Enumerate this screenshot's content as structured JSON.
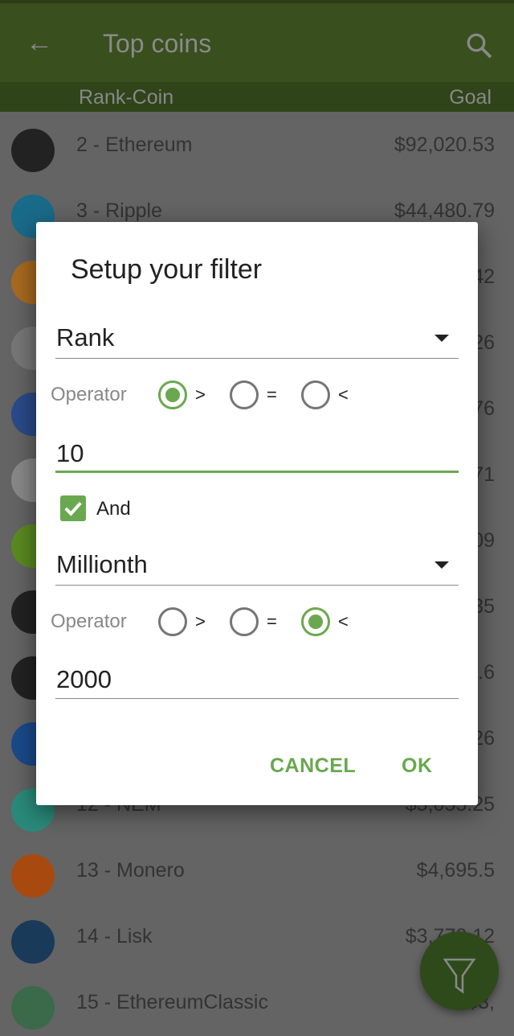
{
  "toolbar": {
    "title": "Top coins",
    "back_icon": "arrow-left-icon",
    "search_icon": "search-icon"
  },
  "header": {
    "rank_coin": "Rank-Coin",
    "goal": "Goal"
  },
  "coins": [
    {
      "name": "2 - Ethereum",
      "value": "$92,020.53",
      "color": "#222222"
    },
    {
      "name": "3 - Ripple",
      "value": "$44,480.79",
      "color": "#1a6a8a"
    },
    {
      "name": "",
      "value": "42",
      "color": "#a86a20"
    },
    {
      "name": "",
      "value": "26",
      "color": "#777777"
    },
    {
      "name": "",
      "value": "76",
      "color": "#2a4a8a"
    },
    {
      "name": "",
      "value": "71",
      "color": "#888888"
    },
    {
      "name": "",
      "value": "09",
      "color": "#5a8a20"
    },
    {
      "name": "",
      "value": "35",
      "color": "#222222"
    },
    {
      "name": "",
      "value": ".6",
      "color": "#222222"
    },
    {
      "name": "",
      "value": "26",
      "color": "#1a4a8a"
    },
    {
      "name": "12 - NEM",
      "value": "$5,055.25",
      "color": "#2a8a7a"
    },
    {
      "name": "13 - Monero",
      "value": "$4,695.5",
      "color": "#a84a10"
    },
    {
      "name": "14 - Lisk",
      "value": "$3,770.12",
      "color": "#1a3a5a"
    },
    {
      "name": "15 - EthereumClassic",
      "value": "$3,",
      "color": "#3a6a4a"
    }
  ],
  "dialog": {
    "title": "Setup your filter",
    "filter1": {
      "field": "Rank",
      "operator_label": "Operator",
      "operators": [
        ">",
        "=",
        "<"
      ],
      "selected": 0,
      "value": "10"
    },
    "and_label": "And",
    "and_checked": true,
    "filter2": {
      "field": "Millionth",
      "operator_label": "Operator",
      "operators": [
        ">",
        "=",
        "<"
      ],
      "selected": 2,
      "value": "2000"
    },
    "cancel": "CANCEL",
    "ok": "OK"
  },
  "fab": {
    "icon": "filter-icon"
  },
  "colors": {
    "accent": "#6aa84f",
    "toolbar": "#3a4f1e"
  }
}
